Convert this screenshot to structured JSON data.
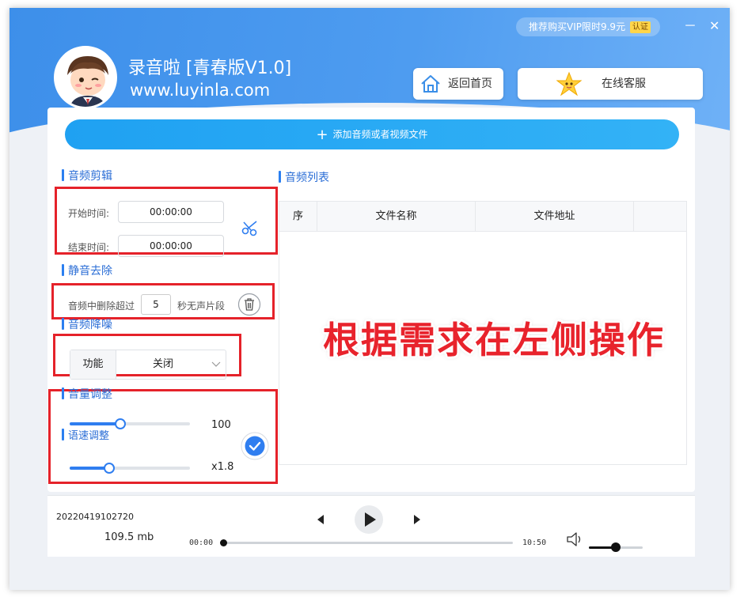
{
  "window": {
    "vip_text": "推荐购买VIP限时9.9元",
    "vip_tag": "认证",
    "minimize_glyph": "－",
    "close_glyph": "✕"
  },
  "app": {
    "title": "录音啦  [青春版V1.0]",
    "url": "www.luyinla.com"
  },
  "header_buttons": {
    "home_label": "返回首页",
    "service_label": "在线客服"
  },
  "add_file": {
    "label": "添加音频或者视频文件"
  },
  "audio_clip": {
    "heading": "音频剪辑",
    "start_label": "开始时间:",
    "start_value": "00:00:00",
    "end_label": "结束时间:",
    "end_value": "00:00:00"
  },
  "silence": {
    "heading": "静音去除",
    "prefix": "音频中删除超过",
    "seconds": "5",
    "suffix": "秒无声片段"
  },
  "denoise": {
    "heading": "音频降噪",
    "key": "功能",
    "value": "关闭"
  },
  "volume": {
    "heading": "音量调整",
    "value_text": "100",
    "level_fraction": 0.42
  },
  "speed": {
    "heading": "语速调整",
    "value_text": "x1.8",
    "level_fraction": 0.33
  },
  "audio_list": {
    "heading": "音频列表",
    "columns": [
      "序",
      "文件名称",
      "文件地址"
    ]
  },
  "overlay_text": "根据需求在左侧操作",
  "player": {
    "file_name": "20220419102720",
    "file_size": "109.5 mb",
    "current_time": "00:00",
    "total_time": "10:50",
    "progress_fraction": 0.0,
    "volume_fraction": 0.5
  },
  "colors": {
    "accent": "#2f7ef0",
    "header_blue": "#4e9cf0",
    "annotation_red": "#e5222a"
  }
}
